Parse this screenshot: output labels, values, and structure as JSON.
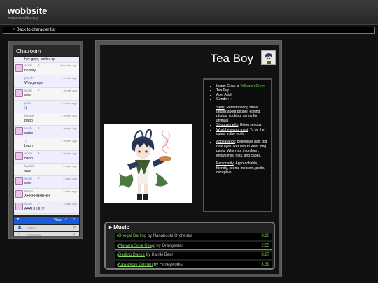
{
  "site": {
    "title": "wobbsite",
    "subtitle": "wobb.neocities.org"
  },
  "back_link": "✓ Back to character list",
  "chat": {
    "title": "Chatroom",
    "top_cut": "hey guys, smiles up",
    "messages": [
      {
        "name": "wobb",
        "flag": "⇗",
        "time": "2 months ago",
        "text": "no way",
        "avatar": true
      },
      {
        "name": "jamrth",
        "flag": "",
        "time": "1 month ago",
        "text": "Wow,people",
        "avatar": false
      },
      {
        "name": "wobb",
        "flag": "⇗",
        "time": "1 month ago",
        "text": "wow",
        "avatar": true
      },
      {
        "name": "poke",
        "flag": "",
        "time": "4 weeks ago",
        "text": ":)",
        "avatar": false
      },
      {
        "name": "krystal",
        "flag": "",
        "time": "4 weeks ago",
        "text": "bwob",
        "avatar": false
      },
      {
        "name": "wobb",
        "flag": "⇗",
        "time": "4 weeks ago",
        "text": "wobb",
        "avatar": true
      },
      {
        "name": ":)",
        "flag": "",
        "time": "2 weeks ago",
        "text": "bwoh",
        "avatar": false
      },
      {
        "name": "wobb",
        "flag": "⇗",
        "time": "2 weeks ago",
        "text": "bwoh",
        "avatar": true
      },
      {
        "name": "krystal",
        "flag": "",
        "time": "5 days ago",
        "text": "woe",
        "avatar": false
      },
      {
        "name": "wobb",
        "flag": "⇗",
        "time": "4 days ago",
        "text": "woe",
        "avatar": true
      },
      {
        "name": "dustin",
        "flag": "",
        "time": "3 days ago",
        "text": "AHHHHHHHHH",
        "avatar": true
      },
      {
        "name": "wobb",
        "flag": "⇗",
        "time": "3 days ago",
        "text": "AAAHHHH!!!",
        "avatar": true
      }
    ],
    "bar_label": "View",
    "name_placeholder": "name",
    "message_placeholder": "message"
  },
  "profile": {
    "name": "Tea Boy",
    "image_color_label": "Image Color: ",
    "image_color_value": "Yellowish Green",
    "tea": "Tea Boy",
    "age": "Age: Adult",
    "gender": "Gender: ♂",
    "skills_label": "Skills",
    "skills": ": Remembering small details about people, editing photos, cooking, caring for animals",
    "struggles_label": "Struggles with",
    "struggles": ": Being serious",
    "wants_label": "What he wants most",
    "wants": ": To be the cutest in the world",
    "appearance_label": "Appearance",
    "appearance": ": Blue/black hair. Big cute eyes. Refuses to wear long pants. When not in uniform, enjoys frills, hats, and capes.",
    "personality_label": "Personality",
    "personality": ": Approachable, friendly, seems innocent, polite, deceptive"
  },
  "music": {
    "title": "Music",
    "tracks": [
      {
        "title": "Onegai Darling",
        "by": " by Nanahoshi Orchestra",
        "time": "3:20"
      },
      {
        "title": "Mawaru Sora Usagi",
        "by": " by Orangestar",
        "time": "2:55"
      },
      {
        "title": "Darling Dance",
        "by": " by Kairiki Bear",
        "time": "3:27"
      },
      {
        "title": "Kawaikute Gomen",
        "by": " by Honeyworks",
        "time": "3:39"
      }
    ]
  },
  "colors": {
    "accent": "#7fd65a",
    "chat_bar": "#1a5bd6"
  }
}
